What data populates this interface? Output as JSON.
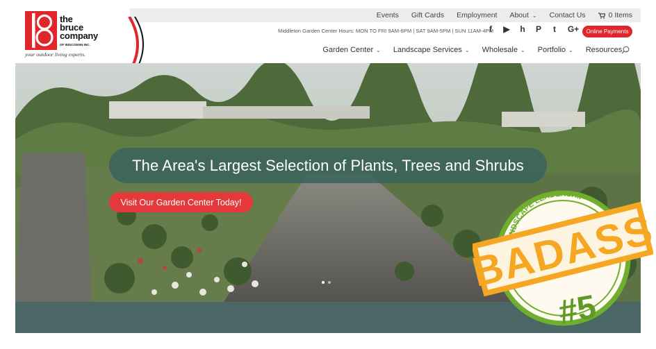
{
  "topbar": {
    "links": [
      "Events",
      "Gift Cards",
      "Employment",
      "About",
      "Contact Us"
    ],
    "cart_label": "0 Items"
  },
  "logo": {
    "name_line1": "the",
    "name_line2": "bruce",
    "name_line3": "company",
    "sub": "OF WISCONSIN INC.",
    "tagline": "your outdoor living experts."
  },
  "hours": "Middleton Garden Center Hours: MON TO FRI 9AM-6PM | SAT 9AM-5PM | SUN 11AM-4PM",
  "online_payments": "Online Payments",
  "nav": {
    "items": [
      "Garden Center",
      "Landscape Services",
      "Wholesale",
      "Portfolio",
      "Resources"
    ]
  },
  "hero": {
    "headline": "The Area's Largest Selection of Plants, Trees and Shrubs",
    "cta": "Visit Our Garden Center Today!"
  },
  "badge": {
    "ring_text": "LANDSCAPE LEADERSHIP",
    "main": "BADASS",
    "rank": "#5"
  },
  "colors": {
    "brand_red": "#e0262b",
    "hero_overlay": "#38615d",
    "band": "#4a6766",
    "badge_orange": "#f5a623",
    "badge_green": "#6fae2e"
  }
}
